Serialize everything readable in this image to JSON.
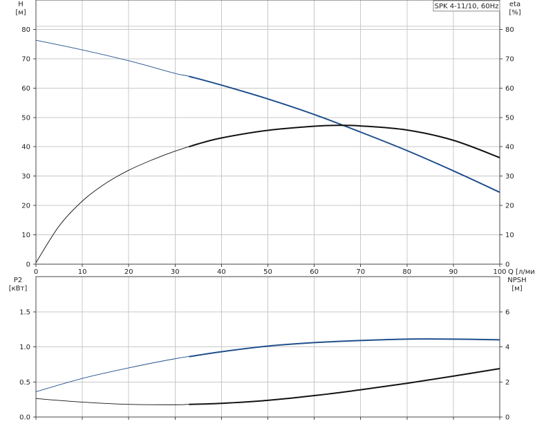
{
  "chart_data": [
    {
      "type": "line",
      "title": "SPK 4-11/10, 60Hz",
      "xlabel": "Q [л/мин]",
      "ylabel_left": [
        "H",
        "[м]"
      ],
      "ylabel_right": [
        "eta",
        "[%]"
      ],
      "xlim": [
        0,
        100
      ],
      "ylim": [
        0,
        90
      ],
      "ylim_right": [
        0,
        90
      ],
      "x_ticks": [
        0,
        10,
        20,
        30,
        40,
        50,
        60,
        70,
        80,
        90,
        100
      ],
      "y_ticks": [
        0,
        10,
        20,
        30,
        40,
        50,
        60,
        70,
        80
      ],
      "y_ticks_right": [
        0,
        10,
        20,
        30,
        40,
        50,
        60,
        70,
        80
      ],
      "grid": true,
      "series": [
        {
          "name": "H",
          "axis": "left",
          "color": "#1f4e8c",
          "x": [
            0,
            10,
            20,
            30,
            33,
            40,
            50,
            60,
            70,
            80,
            90,
            100
          ],
          "y": [
            76.3,
            73.0,
            69.3,
            65.0,
            64.0,
            61.0,
            56.3,
            51.0,
            45.0,
            38.7,
            31.8,
            24.5
          ],
          "highlight_from_x": 33
        },
        {
          "name": "eta",
          "axis": "right",
          "color": "#111111",
          "x": [
            0,
            5,
            10,
            15,
            20,
            25,
            30,
            35,
            40,
            50,
            60,
            65,
            70,
            80,
            90,
            100
          ],
          "y": [
            0.5,
            13.0,
            21.5,
            27.5,
            32.0,
            35.5,
            38.5,
            41.0,
            43.0,
            45.6,
            47.0,
            47.3,
            47.1,
            45.7,
            42.2,
            36.3
          ],
          "highlight_from_x": 33
        }
      ]
    },
    {
      "type": "line",
      "xlabel": "",
      "ylabel_left": [
        "P2",
        "[кВт]"
      ],
      "ylabel_right": [
        "NPSH",
        "[м]"
      ],
      "xlim": [
        0,
        100
      ],
      "ylim": [
        0,
        2
      ],
      "ylim_right": [
        0,
        8
      ],
      "x_ticks": [
        0,
        10,
        20,
        30,
        40,
        50,
        60,
        70,
        80,
        90,
        100
      ],
      "y_ticks": [
        "0.0",
        "0.5",
        "1.0",
        "1.5"
      ],
      "y_ticks_right": [
        0,
        2,
        4,
        6
      ],
      "grid": true,
      "series": [
        {
          "name": "P2",
          "axis": "left",
          "color": "#1f4e8c",
          "x": [
            0,
            10,
            20,
            30,
            40,
            50,
            60,
            70,
            80,
            90,
            100
          ],
          "y": [
            0.36,
            0.55,
            0.7,
            0.83,
            0.93,
            1.01,
            1.06,
            1.09,
            1.11,
            1.11,
            1.1
          ],
          "highlight_from_x": 33
        },
        {
          "name": "NPSH",
          "axis": "right",
          "color": "#111111",
          "x": [
            0,
            10,
            20,
            30,
            33,
            40,
            50,
            60,
            70,
            80,
            90,
            100
          ],
          "y": [
            1.05,
            0.85,
            0.72,
            0.7,
            0.72,
            0.78,
            0.95,
            1.22,
            1.55,
            1.92,
            2.33,
            2.76
          ],
          "highlight_from_x": 33
        }
      ]
    }
  ]
}
